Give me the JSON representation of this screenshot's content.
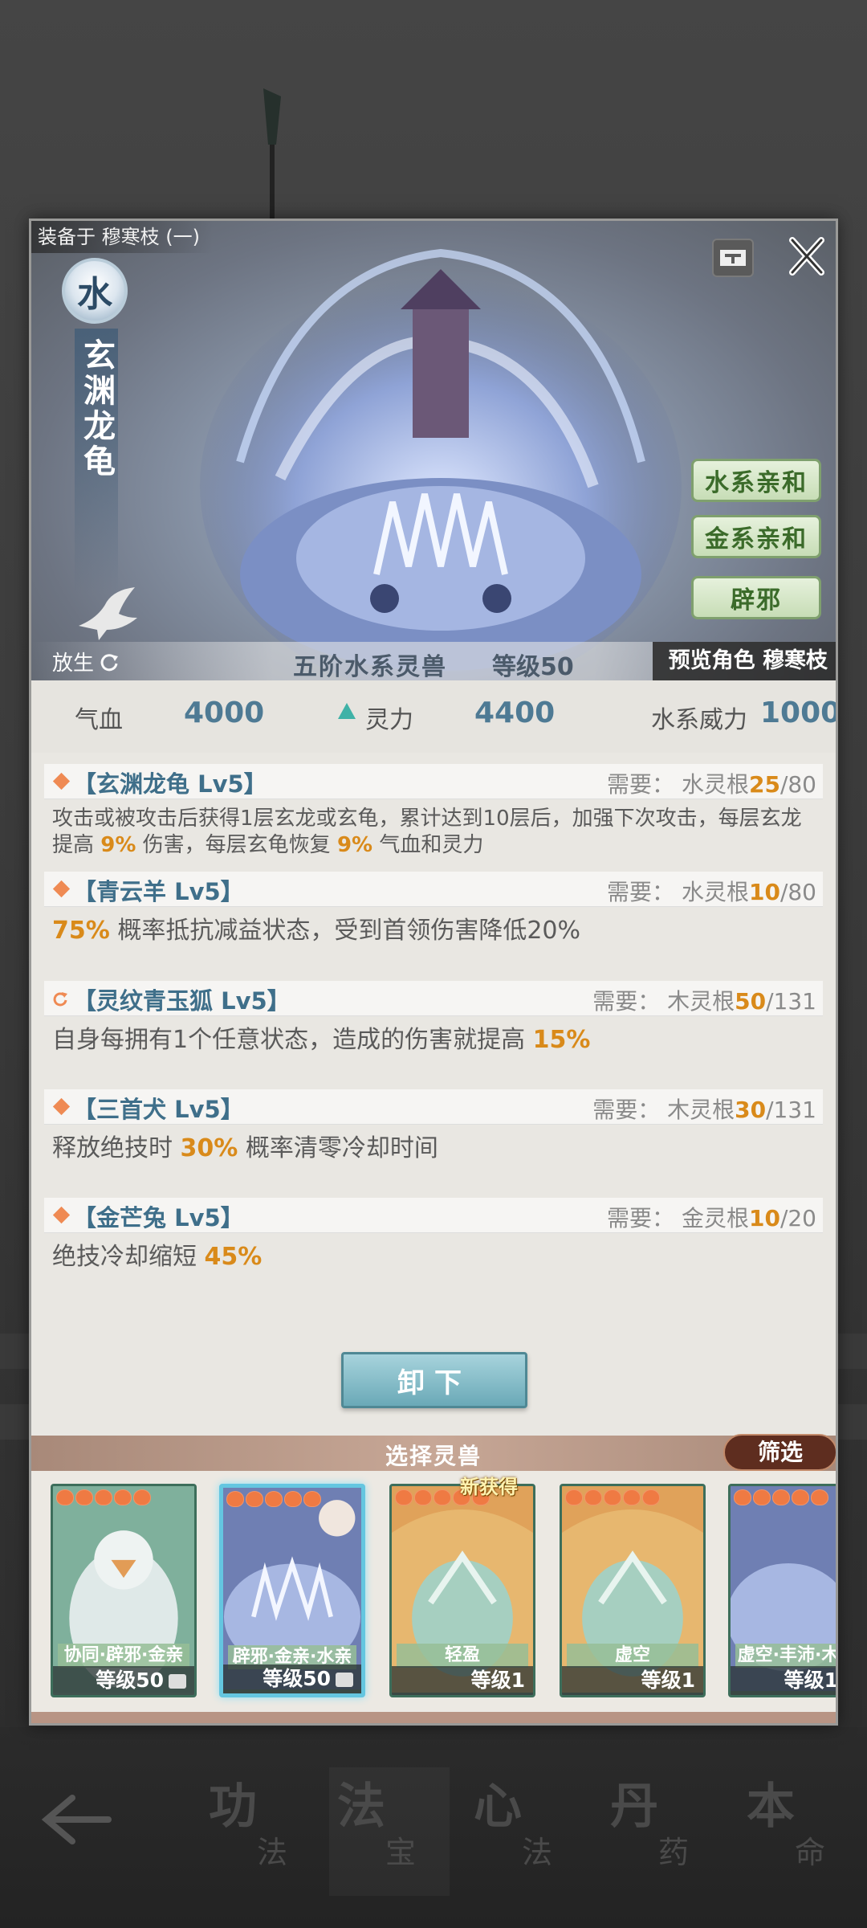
{
  "header": {
    "equipped_label": "装备于 穆寒枝 (一)",
    "ticket_icon": "ticket-icon",
    "close_icon": "close-icon"
  },
  "beast": {
    "element": "水",
    "name": "玄渊龙龟",
    "release_label": "放生",
    "tier": "五阶水系灵兽",
    "level": "等级50",
    "preview_role": "预览角色 穆寒枝",
    "traits": [
      "水系亲和",
      "金系亲和",
      "辟邪"
    ]
  },
  "stats": {
    "hp_label": "气血",
    "hp_value": "4000",
    "sp_label": "灵力",
    "sp_value": "4400",
    "power_label": "水系威力",
    "power_value": "1000"
  },
  "skills": [
    {
      "icon": "diamond-icon",
      "name": "【玄渊龙龟 Lv5】",
      "req_prefix": "需要：",
      "req_root": "水灵根",
      "req_have": "25",
      "req_total": "/80",
      "desc_a": "攻击或被攻击后获得1层玄龙或玄龟，累计达到10层后，加强下次攻击，每层玄龙提高 ",
      "desc_hl1": "9%",
      "desc_b": " 伤害，每层玄龟恢复 ",
      "desc_hl2": "9%",
      "desc_c": " 气血和灵力"
    },
    {
      "icon": "diamond-icon",
      "name": "【青云羊 Lv5】",
      "req_prefix": "需要：",
      "req_root": "水灵根",
      "req_have": "10",
      "req_total": "/80",
      "desc_hl1": "75%",
      "desc_a": " 概率抵抗减益状态，受到首领伤害降低20%"
    },
    {
      "icon": "refresh-icon",
      "name": "【灵纹青玉狐 Lv5】",
      "req_prefix": "需要：",
      "req_root": "木灵根",
      "req_have": "50",
      "req_total": "/131",
      "desc_a": "自身每拥有1个任意状态，造成的伤害就提高 ",
      "desc_hl1": "15%"
    },
    {
      "icon": "diamond-icon",
      "name": "【三首犬 Lv5】",
      "req_prefix": "需要：",
      "req_root": "木灵根",
      "req_have": "30",
      "req_total": "/131",
      "desc_a": "释放绝技时 ",
      "desc_hl1": "30%",
      "desc_b": " 概率清零冷却时间"
    },
    {
      "icon": "diamond-icon",
      "name": "【金芒兔 Lv5】",
      "req_prefix": "需要：",
      "req_root": "金灵根",
      "req_have": "10",
      "req_total": "/20",
      "desc_a": "绝技冷却缩短 ",
      "desc_hl1": "45%"
    }
  ],
  "unequip_label": "卸下",
  "select": {
    "title": "选择灵兽",
    "filter_label": "筛选",
    "new_label": "新获得",
    "cards": [
      {
        "tags": "协同·辟邪·金亲",
        "level": "等级50",
        "locked": true
      },
      {
        "tags": "辟邪·金亲·水亲",
        "level": "等级50",
        "locked": true
      },
      {
        "tags": "轻盈",
        "level": "等级1",
        "locked": false
      },
      {
        "tags": "虚空",
        "level": "等级1",
        "locked": false
      },
      {
        "tags": "虚空·丰沛·木",
        "level": "等级1",
        "locked": false
      }
    ]
  },
  "bottom_nav": {
    "back_icon": "back-arrow-icon",
    "items": [
      {
        "big": "功",
        "small": "法"
      },
      {
        "big": "法",
        "small": "宝"
      },
      {
        "big": "心",
        "small": "法"
      },
      {
        "big": "丹",
        "small": "药"
      },
      {
        "big": "本",
        "small": "命"
      }
    ]
  },
  "colors": {
    "accent_blue": "#4e7a94",
    "highlight_orange": "#d98a1a",
    "trait_green": "#3b6b2a",
    "unequip_teal": "#6aa9b7"
  }
}
